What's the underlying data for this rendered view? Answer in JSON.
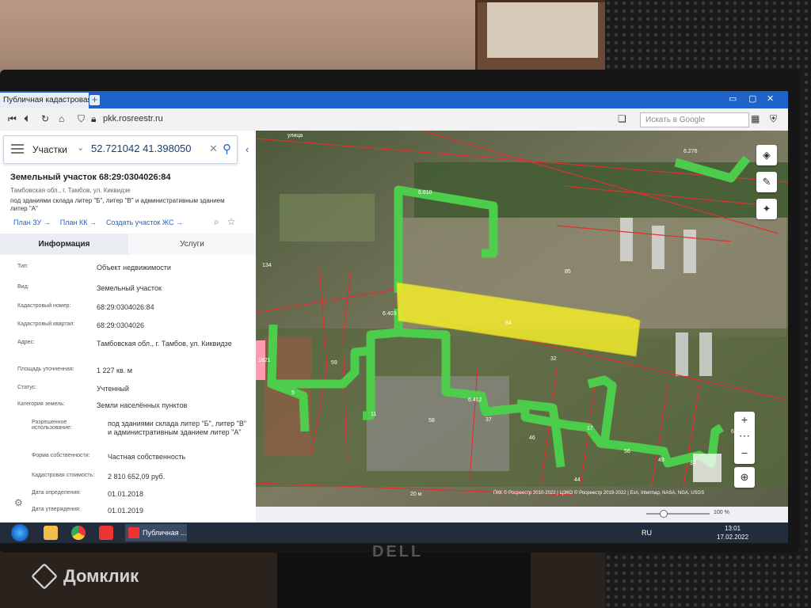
{
  "browser": {
    "tab_title": "Публичная кадастровая к",
    "tab_add": "+",
    "url": "pkk.rosreestr.ru",
    "search_placeholder": "Искать в Google"
  },
  "search": {
    "type": "Участки",
    "value": "52.721042 41.398050"
  },
  "object": {
    "title": "Земельный участок 68:29:0304026:84",
    "address_short": "Тамбовская обл., г. Тамбов, ул. Киквидзе",
    "description": "под зданиями склада литер \"Б\", литер \"В\" и административным зданием литер \"А\"",
    "actions": [
      "План ЗУ →",
      "План КК →",
      "Создать участок ЖС →"
    ]
  },
  "tabs": {
    "info": "Информация",
    "services": "Услуги"
  },
  "info": [
    {
      "key": "Тип:",
      "value": "Объект недвижимости"
    },
    {
      "key": "Вид:",
      "value": "Земельный участок"
    },
    {
      "key": "Кадастровый номер:",
      "value": "68:29:0304026:84"
    },
    {
      "key": "Кадастровый квартал:",
      "value": "68:29:0304026"
    },
    {
      "key": "Адрес:",
      "value": "Тамбовская обл., г. Тамбов, ул. Киквидзе"
    },
    {
      "key": "Площадь уточненная:",
      "value": "1 227 кв. м"
    },
    {
      "key": "Статус:",
      "value": "Учтенный"
    },
    {
      "key": "Категория земель:",
      "value": "Земли населённых пунктов"
    },
    {
      "key": "Разрешенное использование:",
      "value": "под зданиями склада литер \"Б\", литер \"В\" и административным зданием литер \"А\""
    },
    {
      "key": "Форма собственности:",
      "value": "Частная собственность"
    },
    {
      "key": "Кадастровая стоимость:",
      "value": "2 810 652,09 руб."
    },
    {
      "key": "Дата определения:",
      "value": "01.01.2018"
    },
    {
      "key": "Дата утверждения:",
      "value": "01.01.2019"
    }
  ],
  "map": {
    "street_label": "улица",
    "parcel_labels": [
      "6.276",
      "6.610",
      "6.403",
      "6.412",
      "6.18",
      "134",
      "85",
      "84",
      "32",
      "59",
      "5",
      "11",
      "58",
      "37",
      "46",
      "17",
      "56",
      "49",
      "44",
      "34",
      "1821"
    ],
    "scale": "20 м",
    "attribution": "ПКК © Росреестр 2010-2022 | ЦЭКО © Росреестр 2019-2022 | Esri, Intermap, NASA, NGA, USGS",
    "zoom": "100 %"
  },
  "taskbar": {
    "task_label": "Публичная ...",
    "lang": "RU",
    "time": "13:01",
    "date": "17.02.2022"
  },
  "watermark": "Домклик",
  "monitor_brand": "DELL",
  "colors": {
    "accent": "#1e63c8",
    "selected_parcel": "#f2ec2a",
    "parcel_green": "#4cd24c",
    "boundary_red": "#e03030"
  }
}
